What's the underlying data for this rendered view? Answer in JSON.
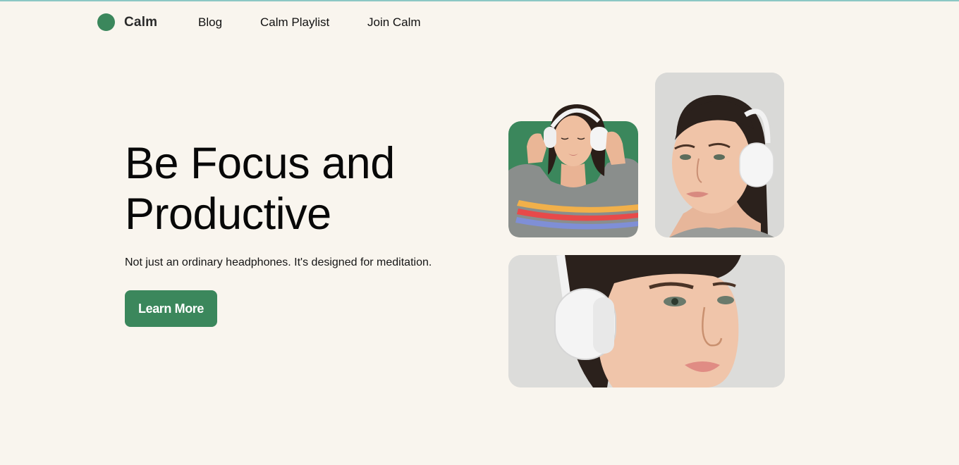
{
  "brand": {
    "name": "Calm",
    "color": "#3b875c"
  },
  "nav": {
    "links": [
      {
        "label": "Blog"
      },
      {
        "label": "Calm Playlist"
      },
      {
        "label": "Join Calm"
      }
    ]
  },
  "hero": {
    "title_line1": "Be Focus and",
    "title_line2": "Productive",
    "subtitle": "Not just an ordinary headphones. It's designed for meditation.",
    "cta_label": "Learn More"
  },
  "gallery": {
    "images": [
      {
        "name": "woman-headphones-green-background"
      },
      {
        "name": "woman-headphones-portrait"
      },
      {
        "name": "woman-headphones-closeup"
      }
    ]
  }
}
